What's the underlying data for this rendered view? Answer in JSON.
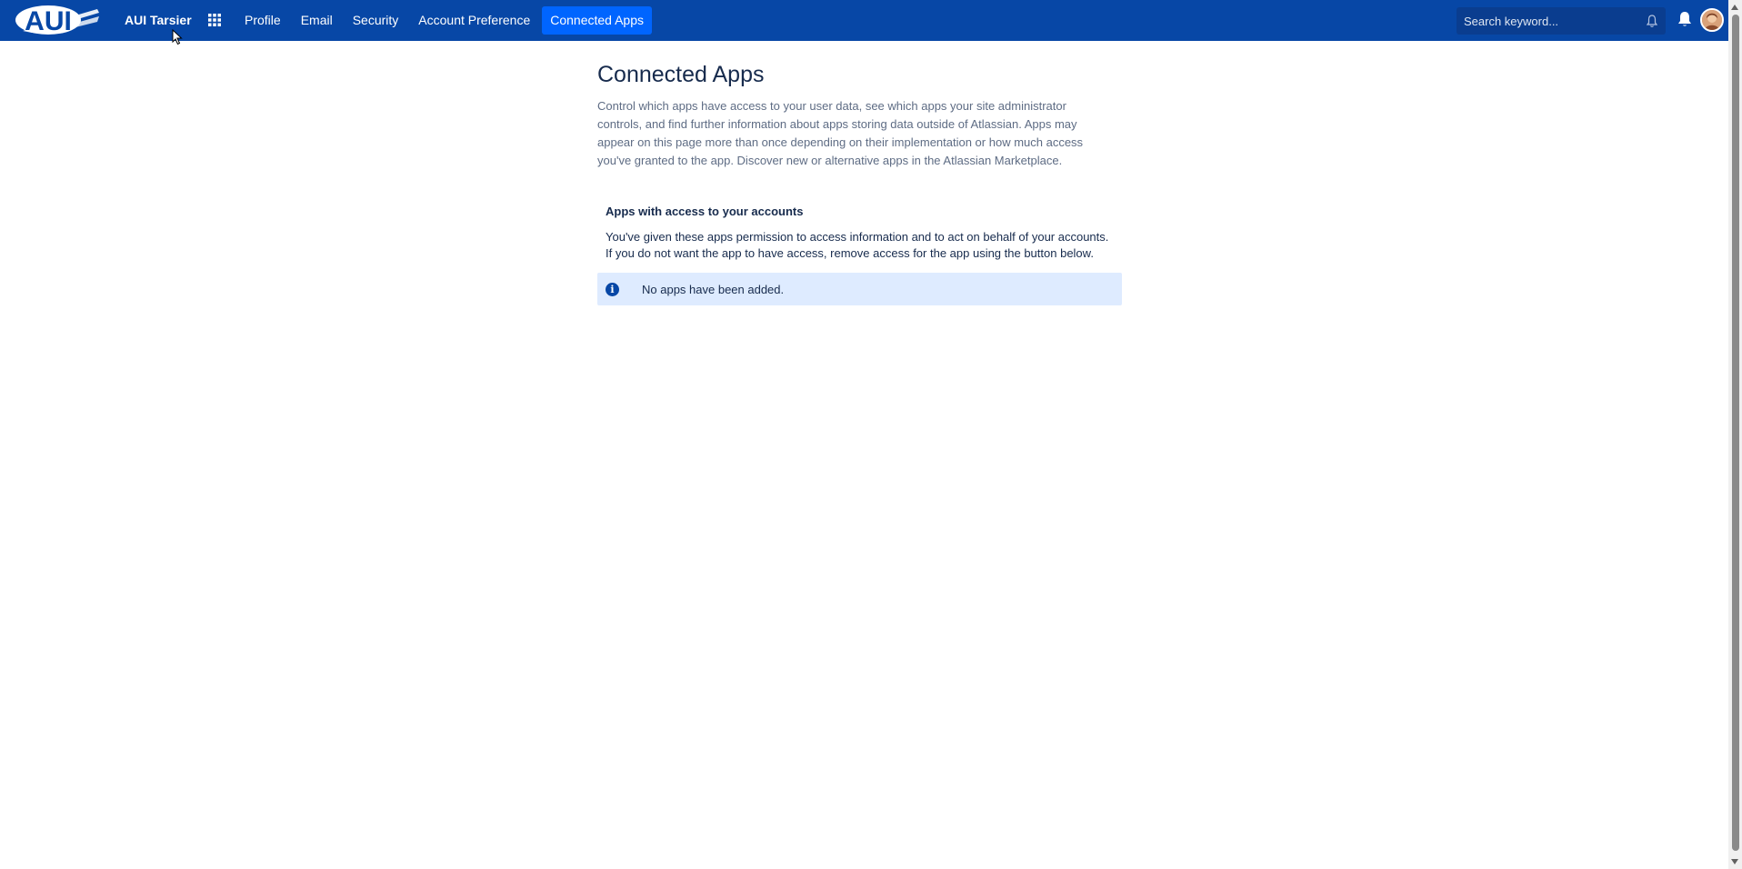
{
  "header": {
    "logo_text": "AUI",
    "brand": "AUI Tarsier",
    "nav": [
      {
        "label": "Profile",
        "active": false
      },
      {
        "label": "Email",
        "active": false
      },
      {
        "label": "Security",
        "active": false
      },
      {
        "label": "Account Preference",
        "active": false
      },
      {
        "label": "Connected Apps",
        "active": true
      }
    ],
    "search": {
      "placeholder": "Search keyword..."
    },
    "colors": {
      "bar": "#0747a6",
      "active_tab": "#0065ff"
    }
  },
  "main": {
    "title": "Connected Apps",
    "description": "Control which apps have access to your user data, see which apps your site administrator controls, and find further information about apps storing data outside of Atlassian. Apps may appear on this page more than once depending on their implementation or how much access you've granted to the app. Discover new or alternative apps in the Atlassian Marketplace.",
    "section": {
      "title": "Apps with access to your accounts",
      "description": "You've given these apps permission to access information and to act on behalf of your accounts. If you do not want the app to have access, remove access for the app using the button below.",
      "empty_message": "No apps have been added.",
      "info_icon_glyph": "i"
    }
  }
}
